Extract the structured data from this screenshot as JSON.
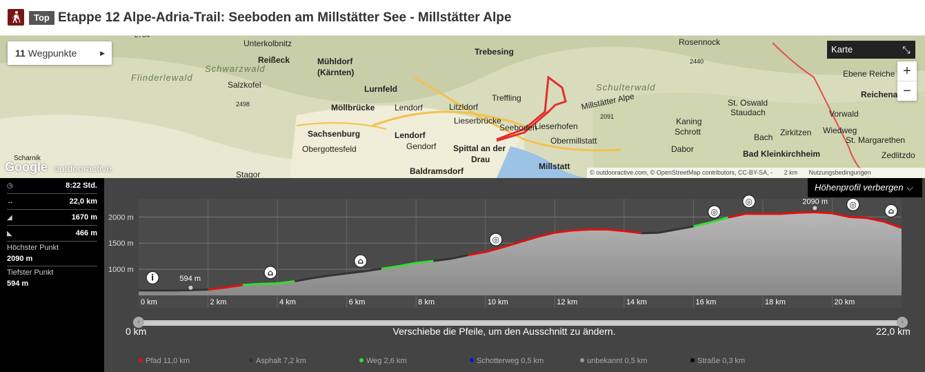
{
  "header": {
    "badge": "Top",
    "title": "Etappe 12 Alpe-Adria-Trail: Seeboden am Millstätter See - Millstätter Alpe"
  },
  "map": {
    "waypoints": {
      "count": "11",
      "label": "Wegpunkte"
    },
    "karte_label": "Karte",
    "zoom_in": "+",
    "zoom_out": "−",
    "google_logo": "Google",
    "oa_logo": "outdooractive",
    "attribution": "© outdooractive.com, © OpenStreetMap contributors, CC-BY-SA, -",
    "scale": "2 km",
    "terms": "Nutzungsbedingungen",
    "labels": [
      {
        "text": "2784",
        "cls": "small"
      },
      {
        "text": "Unterkolbnitz",
        "cls": ""
      },
      {
        "text": "Reißeck",
        "cls": "b"
      },
      {
        "text": "Mühldorf",
        "cls": "b"
      },
      {
        "text": "(Kärnten)",
        "cls": "b"
      },
      {
        "text": "Schwarzwald",
        "cls": "it"
      },
      {
        "text": "Flinderlewald",
        "cls": "it"
      },
      {
        "text": "Salzkofel",
        "cls": ""
      },
      {
        "text": "2498",
        "cls": "small"
      },
      {
        "text": "Lurnfeld",
        "cls": "b"
      },
      {
        "text": "Möllbrücke",
        "cls": "b"
      },
      {
        "text": "Lendorf",
        "cls": ""
      },
      {
        "text": "Sachsenburg",
        "cls": "b"
      },
      {
        "text": "Obergottesfeld",
        "cls": ""
      },
      {
        "text": "Lendorf",
        "cls": "b"
      },
      {
        "text": "Gendorf",
        "cls": ""
      },
      {
        "text": "Baldramsdorf",
        "cls": "b"
      },
      {
        "text": "Stagor",
        "cls": ""
      },
      {
        "text": "Trebesing",
        "cls": "b"
      },
      {
        "text": "Litzldorf",
        "cls": ""
      },
      {
        "text": "Lieserbrücke",
        "cls": ""
      },
      {
        "text": "Spittal an der",
        "cls": "b"
      },
      {
        "text": "Drau",
        "cls": "b"
      },
      {
        "text": "Treffling",
        "cls": ""
      },
      {
        "text": "Seeboden",
        "cls": ""
      },
      {
        "text": "Lieserhofen",
        "cls": ""
      },
      {
        "text": "Obermillstatt",
        "cls": ""
      },
      {
        "text": "Millstatt",
        "cls": "b"
      },
      {
        "text": "Millstätter Alpe",
        "cls": ""
      },
      {
        "text": "2091",
        "cls": "small"
      },
      {
        "text": "Schulterwald",
        "cls": "it"
      },
      {
        "text": "Rosennock",
        "cls": ""
      },
      {
        "text": "2440",
        "cls": "small"
      },
      {
        "text": "Kaning",
        "cls": ""
      },
      {
        "text": "Schrott",
        "cls": ""
      },
      {
        "text": "Dabor",
        "cls": ""
      },
      {
        "text": "St. Oswald",
        "cls": ""
      },
      {
        "text": "Staudach",
        "cls": ""
      },
      {
        "text": "Bach",
        "cls": ""
      },
      {
        "text": "Zirkitzen",
        "cls": ""
      },
      {
        "text": "Bad Kleinkirchheim",
        "cls": "b"
      },
      {
        "text": "Vorwald",
        "cls": ""
      },
      {
        "text": "Wiedweg",
        "cls": ""
      },
      {
        "text": "St. Margarethen",
        "cls": ""
      },
      {
        "text": "Zedlitzdo",
        "cls": ""
      },
      {
        "text": "Ebene Reiche",
        "cls": ""
      },
      {
        "text": "Reichena",
        "cls": "b"
      },
      {
        "text": "Scharnik",
        "cls": ""
      }
    ]
  },
  "stats": {
    "duration": "8:22 Std.",
    "distance": "22,0 km",
    "ascent": "1670 m",
    "descent": "466 m",
    "highest_label": "Höchster Punkt",
    "highest_value": "2090 m",
    "lowest_label": "Tiefster Punkt",
    "lowest_value": "594 m"
  },
  "profile": {
    "hide_label": "Höhenprofil verbergen",
    "slider_start": "0 km",
    "slider_end": "22,0 km",
    "slider_hint": "Verschiebe die Pfeile, um den Ausschnitt zu ändern.",
    "y_ticks": [
      "2000 m",
      "1500 m",
      "1000 m"
    ],
    "x_ticks": [
      "0 km",
      "2 km",
      "4 km",
      "6 km",
      "8 km",
      "10 km",
      "12 km",
      "14 km",
      "16 km",
      "18 km",
      "20 km"
    ],
    "max_label": "2090 m",
    "min_label": "594 m",
    "legend": [
      {
        "label": "Pfad 11,0 km",
        "color": "#e01010"
      },
      {
        "label": "Asphalt 7,2 km",
        "color": "#333333"
      },
      {
        "label": "Weg 2,6 km",
        "color": "#33dd33"
      },
      {
        "label": "Schotterweg 0,5 km",
        "color": "#1010dd"
      },
      {
        "label": "unbekannt 0,5 km",
        "color": "#999999"
      },
      {
        "label": "Straße 0,3 km",
        "color": "#000000"
      }
    ]
  },
  "chart_data": {
    "type": "area",
    "x": [
      0,
      0.5,
      1,
      1.5,
      2,
      2.5,
      3,
      3.5,
      4,
      4.5,
      5,
      5.5,
      6,
      6.5,
      7,
      7.5,
      8,
      8.5,
      9,
      9.5,
      10,
      10.5,
      11,
      11.5,
      12,
      12.5,
      13,
      13.5,
      14,
      14.5,
      15,
      15.5,
      16,
      16.5,
      17,
      17.5,
      18,
      18.5,
      19,
      19.5,
      20,
      20.5,
      21,
      21.5,
      22
    ],
    "y": [
      594,
      594,
      594,
      600,
      610,
      650,
      700,
      720,
      730,
      770,
      830,
      880,
      920,
      960,
      1010,
      1060,
      1120,
      1160,
      1200,
      1270,
      1330,
      1420,
      1520,
      1620,
      1700,
      1740,
      1760,
      1760,
      1730,
      1690,
      1700,
      1760,
      1820,
      1900,
      1990,
      2060,
      2060,
      2060,
      2080,
      2090,
      2070,
      2000,
      1980,
      1910,
      1790
    ],
    "xlabel": "",
    "ylabel": "",
    "ylim": [
      594,
      2200
    ],
    "xlim": [
      0,
      22
    ],
    "grid": true
  }
}
